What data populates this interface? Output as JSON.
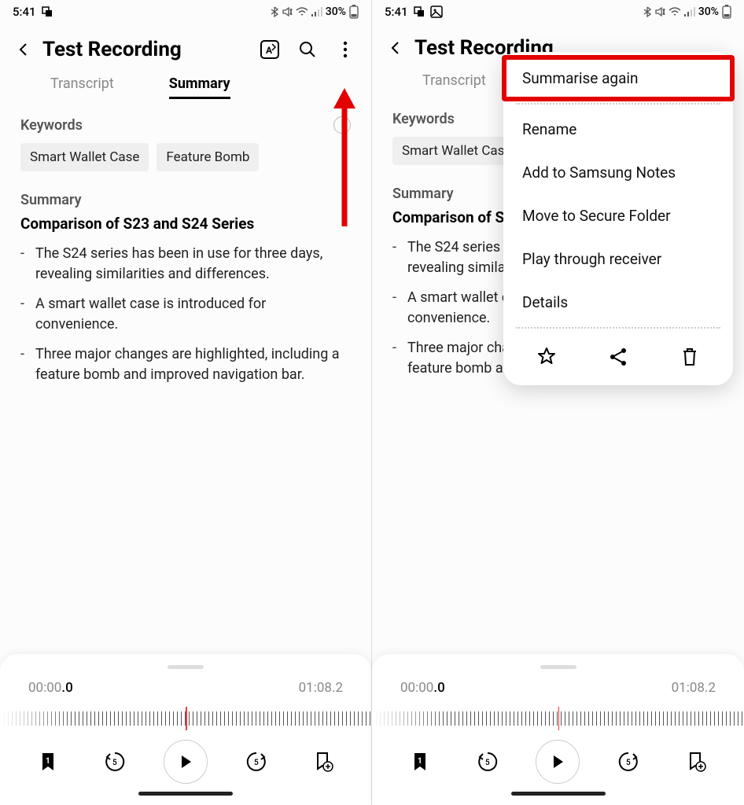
{
  "status": {
    "time": "5:41",
    "battery_pct": "30%"
  },
  "header": {
    "title": "Test Recording"
  },
  "tabs": {
    "transcript": "Transcript",
    "summary": "Summary"
  },
  "keywords": {
    "label": "Keywords",
    "chips": [
      "Smart Wallet Case",
      "Feature Bomb"
    ]
  },
  "summary": {
    "label": "Summary",
    "heading": "Comparison of S23 and S24 Series",
    "bullets": [
      "The S24 series has been in use for three days, revealing similarities and differences.",
      "A smart wallet case is introduced for convenience.",
      "Three major changes are highlighted, including a feature bomb and improved navigation bar."
    ]
  },
  "player": {
    "current": "00:00",
    "current_tenth": ".0",
    "total": "01:08.2",
    "bookmark_count": "1"
  },
  "menu": {
    "items": [
      "Summarise again",
      "Rename",
      "Add to Samsung Notes",
      "Move to Secure Folder",
      "Play through receiver",
      "Details"
    ]
  }
}
